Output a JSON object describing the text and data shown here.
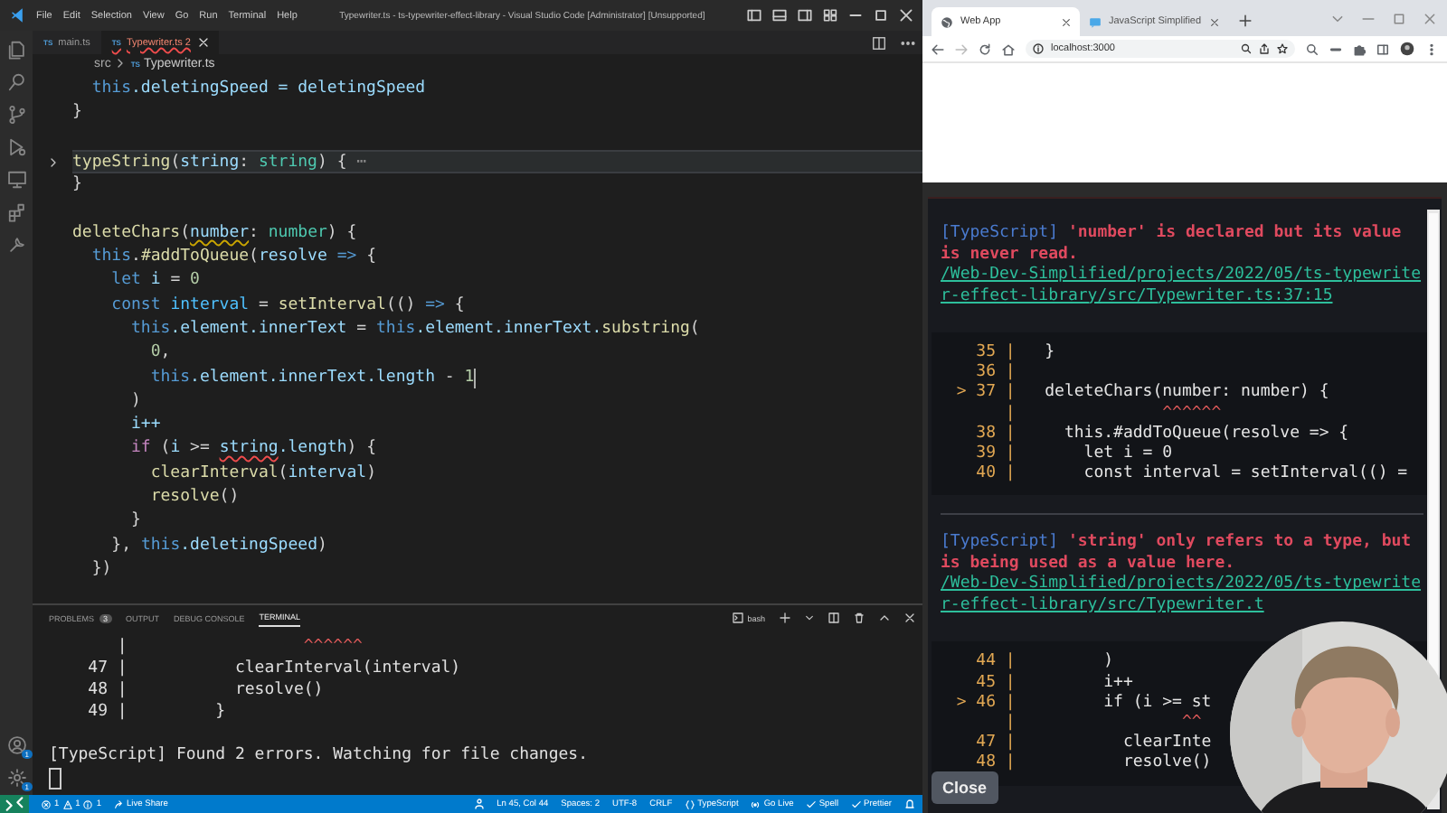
{
  "editor": {
    "title": "Typewriter.ts - ts-typewriter-effect-library - Visual Studio Code [Administrator] [Unsupported]",
    "menu": [
      "File",
      "Edit",
      "Selection",
      "View",
      "Go",
      "Run",
      "Terminal",
      "Help"
    ],
    "tabs": [
      {
        "type_label": "TS",
        "label": "main.ts",
        "selected": false,
        "error": false
      },
      {
        "type_label": "TS",
        "label": "Typewriter.ts 2",
        "selected": true,
        "error": true
      }
    ],
    "breadcrumb": [
      {
        "text": "src"
      },
      {
        "type_label": "TS",
        "text": "Typewriter.ts"
      }
    ],
    "code": [
      {
        "kind": "code",
        "segs": [
          {
            "kind": "keyword",
            "text": "  this"
          },
          {
            "kind": "var",
            "text": ".deletingSpeed = deletingSpeed"
          }
        ]
      },
      {
        "kind": "code",
        "segs": [
          {
            "kind": "plain",
            "text": "}"
          }
        ]
      },
      {
        "kind": "blank"
      },
      {
        "kind": "code",
        "current": true,
        "folded": true,
        "segs": [
          {
            "kind": "func",
            "text": "typeString"
          },
          {
            "kind": "plain",
            "text": "("
          },
          {
            "kind": "var",
            "text": "string"
          },
          {
            "kind": "plain",
            "text": ": "
          },
          {
            "kind": "type",
            "text": "string"
          },
          {
            "kind": "plain",
            "text": ") { "
          },
          {
            "kind": "faint",
            "text": "⋯"
          }
        ]
      },
      {
        "kind": "code",
        "segs": [
          {
            "kind": "plain",
            "text": "}"
          }
        ]
      },
      {
        "kind": "blank"
      },
      {
        "kind": "code",
        "segs": [
          {
            "kind": "func",
            "text": "deleteChars"
          },
          {
            "kind": "plain",
            "text": "("
          },
          {
            "kind": "warn",
            "text": "number"
          },
          {
            "kind": "plain",
            "text": ": "
          },
          {
            "kind": "type",
            "text": "number"
          },
          {
            "kind": "plain",
            "text": ") {"
          }
        ]
      },
      {
        "kind": "code",
        "segs": [
          {
            "kind": "keyword",
            "text": "  this"
          },
          {
            "kind": "plain",
            "text": "."
          },
          {
            "kind": "func",
            "text": "#addToQueue"
          },
          {
            "kind": "plain",
            "text": "("
          },
          {
            "kind": "var",
            "text": "resolve"
          },
          {
            "kind": "keyword",
            "text": " =>"
          },
          {
            "kind": "plain",
            "text": " {"
          }
        ]
      },
      {
        "kind": "code",
        "segs": [
          {
            "kind": "keyword",
            "text": "    let"
          },
          {
            "kind": "var",
            "text": " i"
          },
          {
            "kind": "plain",
            "text": " = "
          },
          {
            "kind": "num",
            "text": "0"
          }
        ]
      },
      {
        "kind": "code",
        "segs": [
          {
            "kind": "keyword",
            "text": "    const"
          },
          {
            "kind": "const",
            "text": " interval"
          },
          {
            "kind": "plain",
            "text": " = "
          },
          {
            "kind": "func",
            "text": "setInterval"
          },
          {
            "kind": "plain",
            "text": "(()"
          },
          {
            "kind": "keyword",
            "text": " =>"
          },
          {
            "kind": "plain",
            "text": " {"
          }
        ]
      },
      {
        "kind": "code",
        "segs": [
          {
            "kind": "keyword",
            "text": "      this"
          },
          {
            "kind": "var",
            "text": ".element.innerText"
          },
          {
            "kind": "plain",
            "text": " = "
          },
          {
            "kind": "keyword",
            "text": "this"
          },
          {
            "kind": "var",
            "text": ".element.innerText."
          },
          {
            "kind": "func",
            "text": "substring"
          },
          {
            "kind": "plain",
            "text": "("
          }
        ]
      },
      {
        "kind": "code",
        "segs": [
          {
            "kind": "num",
            "text": "        0"
          },
          {
            "kind": "plain",
            "text": ","
          }
        ]
      },
      {
        "kind": "code",
        "cursor": true,
        "segs": [
          {
            "kind": "keyword",
            "text": "        this"
          },
          {
            "kind": "var",
            "text": ".element.innerText.length"
          },
          {
            "kind": "plain",
            "text": " - "
          },
          {
            "kind": "num",
            "text": "1"
          }
        ]
      },
      {
        "kind": "code",
        "segs": [
          {
            "kind": "plain",
            "text": "      )"
          }
        ]
      },
      {
        "kind": "code",
        "segs": [
          {
            "kind": "var",
            "text": "      i++"
          }
        ]
      },
      {
        "kind": "code",
        "segs": [
          {
            "kind": "ctrl",
            "text": "      if"
          },
          {
            "kind": "plain",
            "text": " ("
          },
          {
            "kind": "var",
            "text": "i"
          },
          {
            "kind": "plain",
            "text": " >= "
          },
          {
            "kind": "err",
            "text": "string"
          },
          {
            "kind": "var",
            "text": ".length"
          },
          {
            "kind": "plain",
            "text": ") {"
          }
        ]
      },
      {
        "kind": "code",
        "segs": [
          {
            "kind": "func",
            "text": "        clearInterval"
          },
          {
            "kind": "plain",
            "text": "("
          },
          {
            "kind": "var",
            "text": "interval"
          },
          {
            "kind": "plain",
            "text": ")"
          }
        ]
      },
      {
        "kind": "code",
        "segs": [
          {
            "kind": "func",
            "text": "        resolve"
          },
          {
            "kind": "plain",
            "text": "()"
          }
        ]
      },
      {
        "kind": "code",
        "segs": [
          {
            "kind": "plain",
            "text": "      }"
          }
        ]
      },
      {
        "kind": "code",
        "segs": [
          {
            "kind": "plain",
            "text": "    }, "
          },
          {
            "kind": "keyword",
            "text": "this"
          },
          {
            "kind": "var",
            "text": ".deletingSpeed"
          },
          {
            "kind": "plain",
            "text": ")"
          }
        ]
      },
      {
        "kind": "code",
        "segs": [
          {
            "kind": "plain",
            "text": "  })"
          }
        ]
      }
    ],
    "panel": {
      "tabs": [
        {
          "label": "PROBLEMS",
          "badge": "3",
          "selected": false
        },
        {
          "label": "OUTPUT",
          "selected": false
        },
        {
          "label": "DEBUG CONSOLE",
          "selected": false
        },
        {
          "label": "TERMINAL",
          "selected": true
        }
      ],
      "shell": "bash",
      "lines": [
        {
          "kind": "marker",
          "gutter": "       |",
          "marker": "                  ^^^^^^"
        },
        {
          "kind": "text",
          "text": "    47 |           clearInterval(interval)"
        },
        {
          "kind": "text",
          "text": "    48 |           resolve()"
        },
        {
          "kind": "text",
          "text": "    49 |         }"
        },
        {
          "kind": "blank"
        },
        {
          "kind": "text",
          "text": "[TypeScript] Found 2 errors. Watching for file changes."
        }
      ],
      "cursor": true
    },
    "account_badge": "1",
    "settings_badge": "1",
    "status_bar": {
      "errors": "1",
      "warnings": "1",
      "infos": "1",
      "live_share": "Live Share",
      "items": [
        {
          "kind": "person",
          "text": "Ln 45, Col 44"
        },
        {
          "kind": "plain",
          "text": "Spaces: 2"
        },
        {
          "kind": "plain",
          "text": "UTF-8"
        },
        {
          "kind": "plain",
          "text": "CRLF"
        },
        {
          "kind": "braces",
          "text": "TypeScript"
        },
        {
          "kind": "broadcast",
          "text": "Go Live"
        },
        {
          "kind": "check",
          "text": "Spell"
        },
        {
          "kind": "check",
          "text": "Prettier"
        }
      ]
    }
  },
  "browser": {
    "tabs": [
      {
        "title": "Web App",
        "selected": true
      },
      {
        "title": "JavaScript Simplified",
        "selected": false
      }
    ],
    "url": "localhost:3000",
    "overlay": {
      "errors": [
        {
          "tag": "[TypeScript]",
          "message": "'number' is declared but its value is never read.",
          "link": "/Web-Dev-Simplified/projects/2022/05/ts-typewriter-effect-library/src/Typewriter.ts:37:15",
          "frame": [
            {
              "gutter": "    35 |",
              "code": "   }"
            },
            {
              "gutter": "    36 |"
            },
            {
              "gutter": "  > 37 |",
              "code": "   deleteChars(number: number) {"
            },
            {
              "gutter": "       |",
              "marker": "               ^^^^^^"
            },
            {
              "gutter": "    38 |",
              "code": "     this.#addToQueue(resolve => {"
            },
            {
              "gutter": "    39 |",
              "code": "       let i = 0"
            },
            {
              "gutter": "    40 |",
              "code": "       const interval = setInterval(() ="
            }
          ]
        },
        {
          "tag": "[TypeScript]",
          "message": "'string' only refers to a type, but is being used as a value here.",
          "link": "/Web-Dev-Simplified/projects/2022/05/ts-typewriter-effect-library/src/Typewriter.t",
          "frame": [
            {
              "gutter": "    44 |",
              "code": "         )"
            },
            {
              "gutter": "    45 |",
              "code": "         i++"
            },
            {
              "gutter": "  > 46 |",
              "code": "         if (i >= st"
            },
            {
              "gutter": "       |",
              "marker": "                 ^^"
            },
            {
              "gutter": "    47 |",
              "code": "           clearInte"
            },
            {
              "gutter": "    48 |",
              "code": "           resolve()"
            }
          ]
        }
      ],
      "close": "Close"
    }
  }
}
